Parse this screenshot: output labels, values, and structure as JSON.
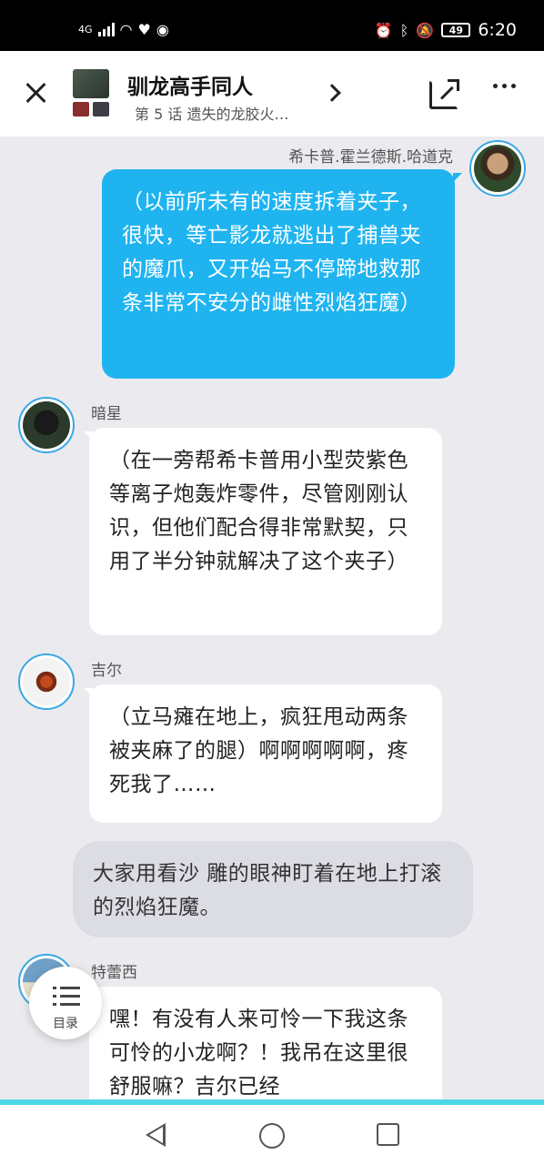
{
  "status_bar": {
    "network": "4G",
    "battery": "49",
    "time": "6:20",
    "icons": [
      "signal-icon",
      "wifi-icon",
      "heart-rate-icon",
      "wechat-icon",
      "alarm-icon",
      "bluetooth-icon",
      "mute-icon",
      "battery-icon"
    ]
  },
  "header": {
    "title": "驯龙高手同人",
    "subtitle": "第 5 话 遗失的龙胶火…"
  },
  "messages": [
    {
      "side": "right",
      "name": "希卡普.霍兰德斯.哈道克",
      "text": "（以前所未有的速度拆着夹子，很快，等亡影龙就逃出了捕兽夹的魔爪，又开始马不停蹄地救那条非常不安分的雌性烈焰狂魔）"
    },
    {
      "side": "left",
      "name": "暗星",
      "text": "（在一旁帮希卡普用小型荧紫色等离子炮轰炸零件，尽管刚刚认识，但他们配合得非常默契，只用了半分钟就解决了这个夹子）"
    },
    {
      "side": "left",
      "name": "吉尔",
      "text": "（立马瘫在地上，疯狂甩动两条被夹麻了的腿）啊啊啊啊啊，疼死我了……"
    },
    {
      "side": "narration",
      "text": "大家用看沙 雕的眼神盯着在地上打滚的烈焰狂魔。"
    },
    {
      "side": "left",
      "name": "特蕾西",
      "text": "嘿！有没有人来可怜一下我这条可怜的小龙啊？！我吊在这里很舒服嘛？吉尔已经"
    }
  ],
  "toc": {
    "label": "目录"
  },
  "colors": {
    "accent": "#1fb4f0",
    "progress": "#4ed8e6",
    "background": "#ebebef"
  }
}
